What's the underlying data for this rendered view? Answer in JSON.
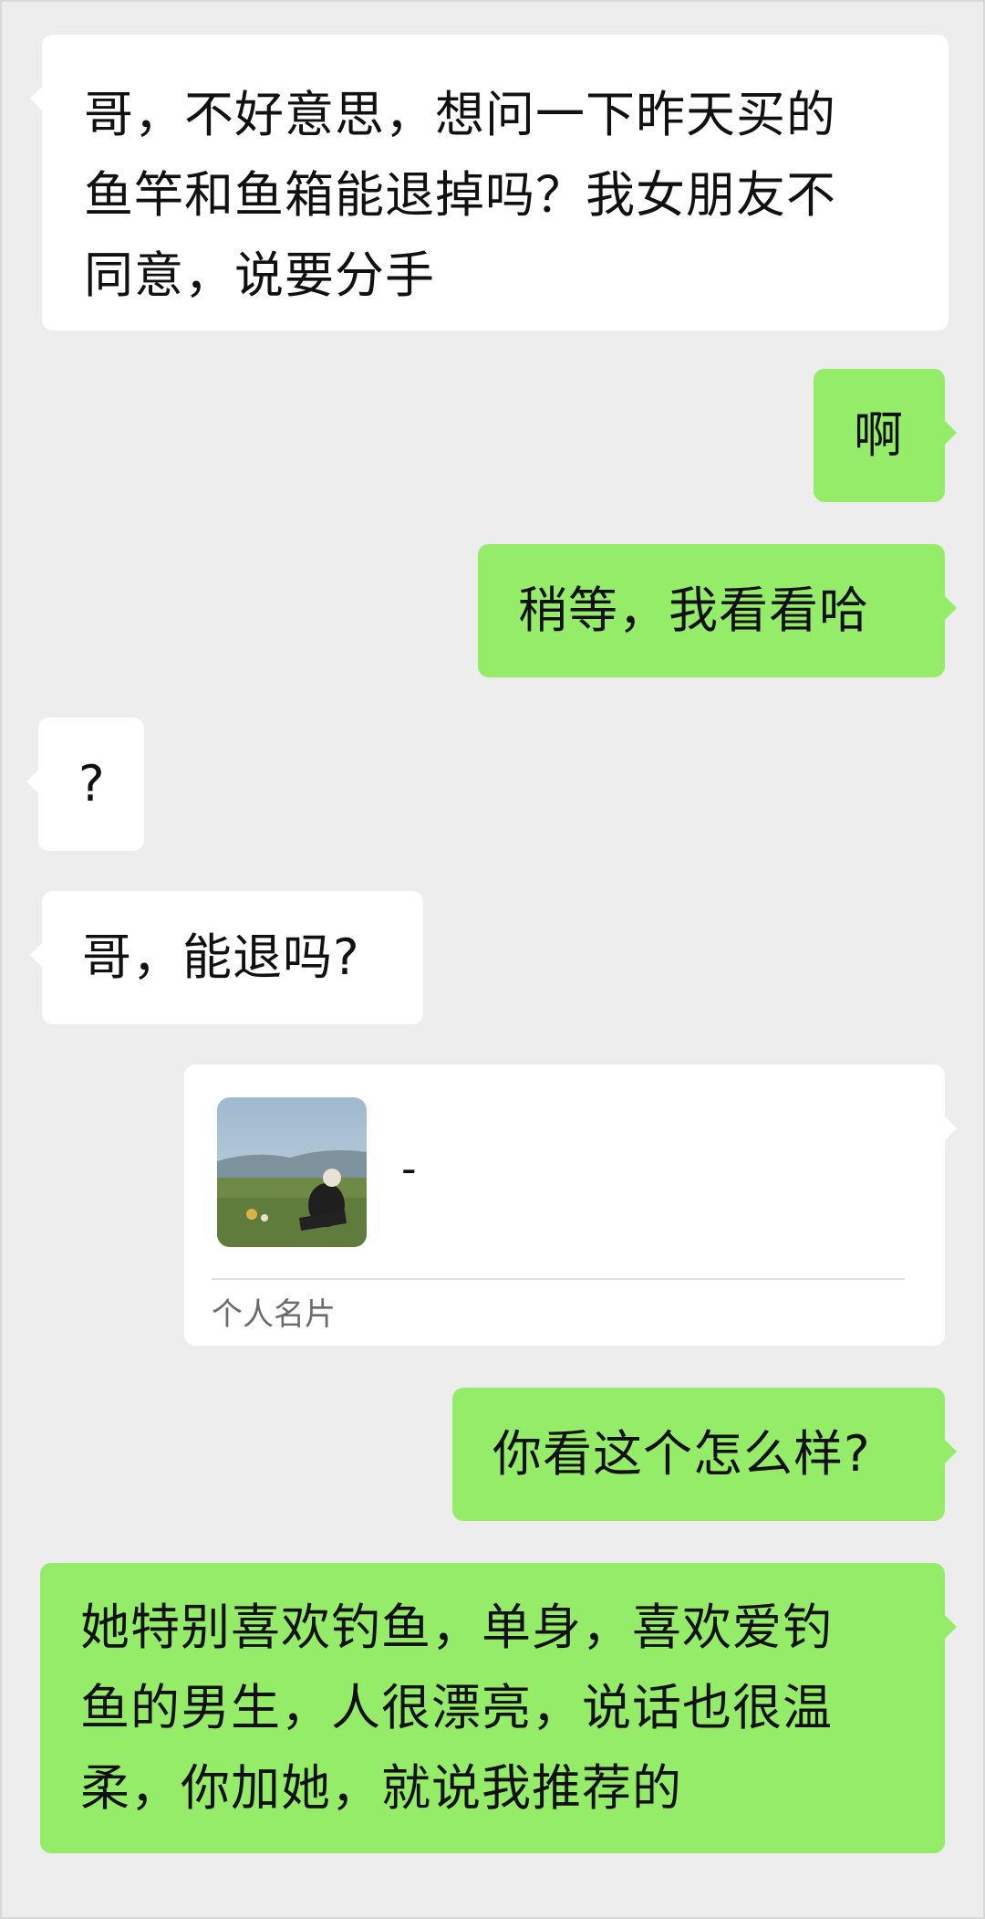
{
  "messages": [
    {
      "side": "in",
      "text": "哥，不好意思，想问一下昨天买的\n鱼竿和鱼箱能退掉吗？我女朋友不\n同意，说要分手"
    },
    {
      "side": "out",
      "text": "啊"
    },
    {
      "side": "out",
      "text": "稍等，我看看哈"
    },
    {
      "side": "in",
      "text": "?"
    },
    {
      "side": "in",
      "text": "哥，能退吗?"
    },
    {
      "side": "out",
      "text": "你看这个怎么样?"
    },
    {
      "side": "out",
      "text": "她特别喜欢钓鱼，单身，喜欢爱钓\n鱼的男生，人很漂亮，说话也很温\n柔，你加她，就说我推荐的"
    }
  ],
  "contact_card": {
    "name": "-",
    "type_label": "个人名片"
  },
  "colors": {
    "background": "#ededed",
    "incoming_bubble": "#ffffff",
    "outgoing_bubble": "#95ec69"
  }
}
